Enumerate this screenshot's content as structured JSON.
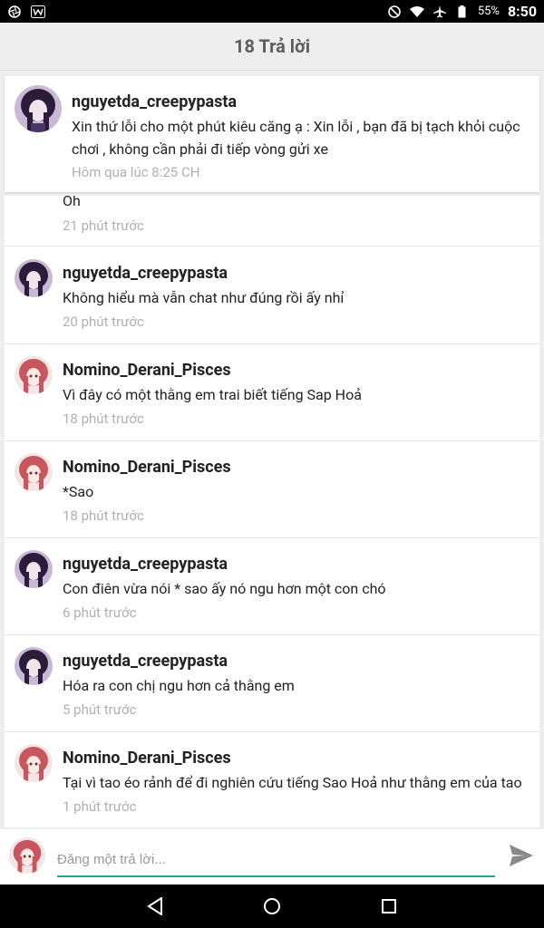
{
  "status_bar": {
    "battery": "55%",
    "time": "8:50"
  },
  "header": {
    "title": "18 Trả lời"
  },
  "original_post": {
    "username": "nguyetda_creepypasta",
    "text": "Xin thứ lỗi cho một phút kiêu căng ạ : Xin lỗi , bạn đã bị tạch khỏi cuộc chơi , không cần phải đi tiếp vòng gửi xe",
    "time": "Hôm qua lúc 8:25 CH"
  },
  "partial_reply": {
    "text": "Oh",
    "time": "21 phút trước"
  },
  "replies": [
    {
      "username": "nguyetda_creepypasta",
      "text": "Không hiểu mà vẫn chat như đúng rồi ấy nhỉ",
      "time": "20 phút trước",
      "avatar": "dark"
    },
    {
      "username": "Nomino_Derani_Pisces",
      "text": "Vì đây có một thằng em trai biết tiếng Sap Hoả",
      "time": "18 phút trước",
      "avatar": "red"
    },
    {
      "username": "Nomino_Derani_Pisces",
      "text": "*Sao",
      "time": "18 phút trước",
      "avatar": "red"
    },
    {
      "username": "nguyetda_creepypasta",
      "text": "Con điên vừa nói * sao ấy nó ngu hơn một con chó",
      "time": "6 phút trước",
      "avatar": "dark"
    },
    {
      "username": "nguyetda_creepypasta",
      "text": "Hóa ra con chị ngu hơn cả thằng em",
      "time": "5 phút trước",
      "avatar": "dark"
    },
    {
      "username": "Nomino_Derani_Pisces",
      "text": "Tại vì tao éo rảnh để đi nghiên cứu tiếng Sao Hoả như thằng em của tao",
      "time": "1 phút trước",
      "avatar": "red"
    }
  ],
  "composer": {
    "placeholder": "Đăng một trả lời..."
  },
  "colors": {
    "accent": "#26a69a",
    "timestamp": "#b0b0b0"
  }
}
